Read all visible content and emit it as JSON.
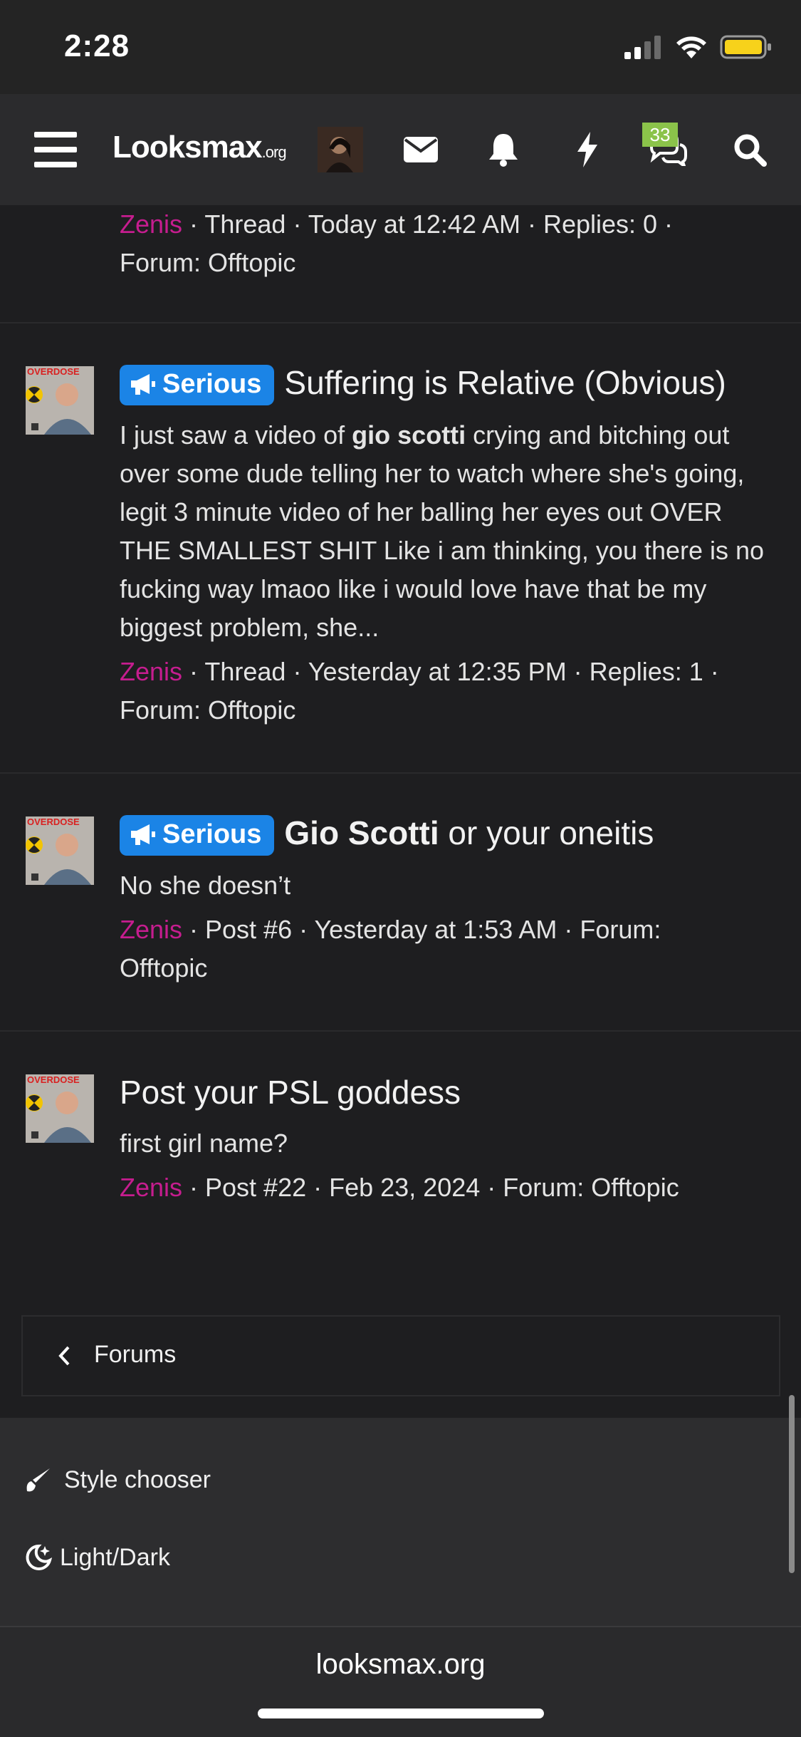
{
  "status": {
    "time": "2:28"
  },
  "nav": {
    "logo_main": "Looksmax",
    "logo_suffix": ".org",
    "conversations_badge": "33"
  },
  "results": [
    {
      "author": "Zenis",
      "meta_line1": " · Thread · Today at 12:42 AM · Replies: 0 ·",
      "meta_line2": "Forum: Offtopic"
    },
    {
      "prefix": "Serious",
      "title": "Suffering is Relative (Obvious)",
      "snippet_before": "I just saw a video of ",
      "snippet_bold": "gio scotti",
      "snippet_after": " crying and bitching out over some dude telling her to watch where she's going, legit 3 minute video of her balling her eyes out OVER THE SMALLEST SHIT Like i am thinking, you there is no fucking way lmaoo like i would love have that be my biggest problem, she...",
      "author": "Zenis",
      "meta_line1": " · Thread · Yesterday at 12:35 PM · Replies: 1 ·",
      "meta_line2": "Forum: Offtopic",
      "avatar_label": "OVERDOSE"
    },
    {
      "prefix": "Serious",
      "title_bold": "Gio Scotti",
      "title_rest": " or your oneitis",
      "snippet": "No she doesn’t",
      "author": "Zenis",
      "meta_line1": " · Post #6 · Yesterday at 1:53 AM · Forum:",
      "meta_line2": "Offtopic",
      "avatar_label": "OVERDOSE"
    },
    {
      "title": "Post your PSL goddess",
      "snippet": "first girl name?",
      "author": "Zenis",
      "meta_line1": " · Post #22 · Feb 23, 2024 · Forum: Offtopic",
      "avatar_label": "OVERDOSE"
    }
  ],
  "breadcrumb": {
    "label": "Forums"
  },
  "footer": {
    "style_chooser": "Style chooser",
    "light_dark": "Light/Dark"
  },
  "browser": {
    "url": "looksmax.org"
  },
  "colors": {
    "accent_blue": "#1b84e6",
    "author_magenta": "#c61d8f",
    "badge_green": "#8bc34a",
    "background": "#1e1e20"
  }
}
